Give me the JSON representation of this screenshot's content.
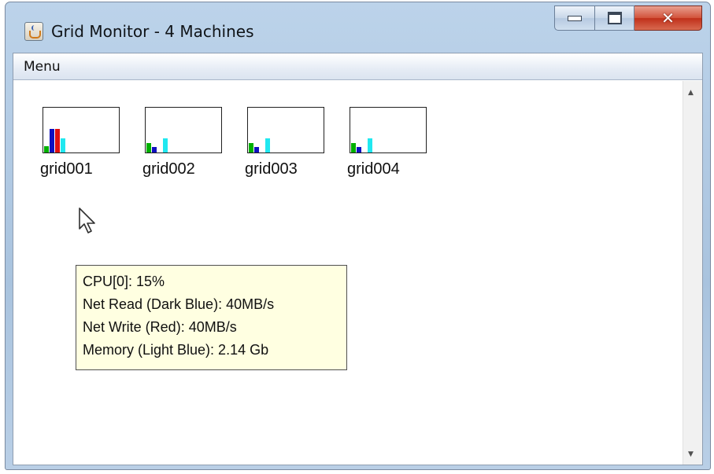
{
  "window": {
    "title": "Grid Monitor - 4 Machines",
    "app_icon": "java-cup-icon",
    "controls": [
      "minimize-icon",
      "maximize-icon",
      "close-icon"
    ]
  },
  "menubar": {
    "items": [
      "Menu"
    ]
  },
  "colors": {
    "cpu": "#00b000",
    "net_read": "#1010c0",
    "net_write": "#e01010",
    "memory": "#20e8f0",
    "tooltip_bg": "#ffffe1"
  },
  "machines": [
    {
      "name": "grid001",
      "cpu": 0.15,
      "net_read": 0.55,
      "net_write": 0.55,
      "memory": 0.32
    },
    {
      "name": "grid002",
      "cpu": 0.22,
      "net_read": 0.12,
      "net_write": 0.0,
      "memory": 0.32
    },
    {
      "name": "grid003",
      "cpu": 0.22,
      "net_read": 0.12,
      "net_write": 0.0,
      "memory": 0.32
    },
    {
      "name": "grid004",
      "cpu": 0.22,
      "net_read": 0.12,
      "net_write": 0.0,
      "memory": 0.32
    }
  ],
  "tooltip": {
    "lines": [
      "CPU[0]: 15%",
      "Net Read (Dark Blue): 40MB/s",
      "Net Write (Red): 40MB/s",
      "Memory (Light Blue): 2.14 Gb"
    ]
  },
  "scrollbar": {
    "up_icon": "scroll-up-arrow-icon",
    "down_icon": "scroll-down-arrow-icon"
  }
}
